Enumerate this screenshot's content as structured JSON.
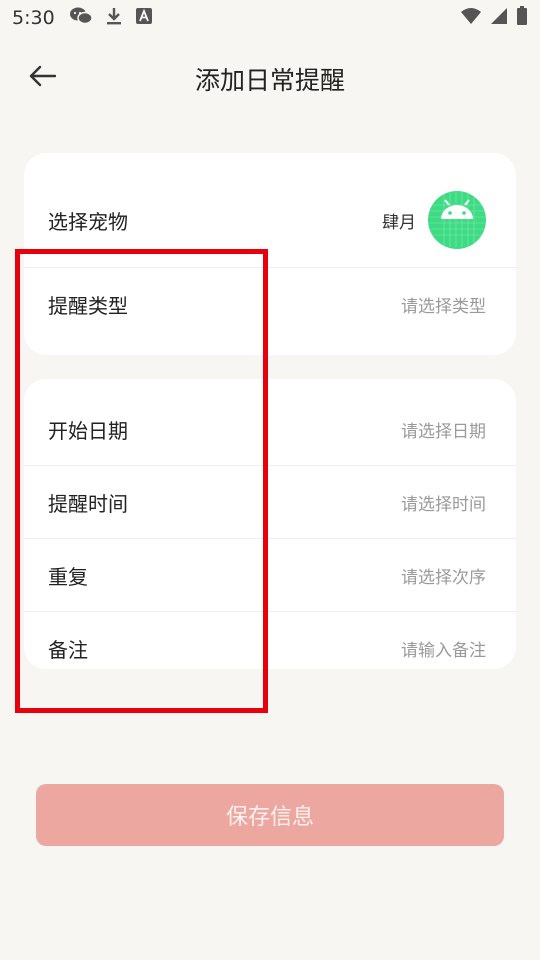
{
  "status_bar": {
    "time": "5:30",
    "left_icons": [
      "wechat-icon",
      "download-icon",
      "font-a-icon"
    ],
    "right_icons": [
      "wifi-icon",
      "signal-icon",
      "battery-icon"
    ]
  },
  "header": {
    "title": "添加日常提醒",
    "back_icon": "arrow-left-icon"
  },
  "pet_card": {
    "pet": {
      "label": "选择宠物",
      "value": "肆月",
      "avatar_icon": "android-icon"
    },
    "type": {
      "label": "提醒类型",
      "placeholder": "请选择类型"
    }
  },
  "schedule_card": {
    "start_date": {
      "label": "开始日期",
      "placeholder": "请选择日期"
    },
    "time": {
      "label": "提醒时间",
      "placeholder": "请选择时间"
    },
    "repeat": {
      "label": "重复",
      "placeholder": "请选择次序"
    },
    "note": {
      "label": "备注",
      "placeholder": "请输入备注"
    }
  },
  "save_button": {
    "label": "保存信息"
  },
  "colors": {
    "background": "#f8f6f2",
    "card": "#ffffff",
    "accent_button": "#eca8a0",
    "avatar": "#3ddc84",
    "highlight": "#e8000c"
  }
}
